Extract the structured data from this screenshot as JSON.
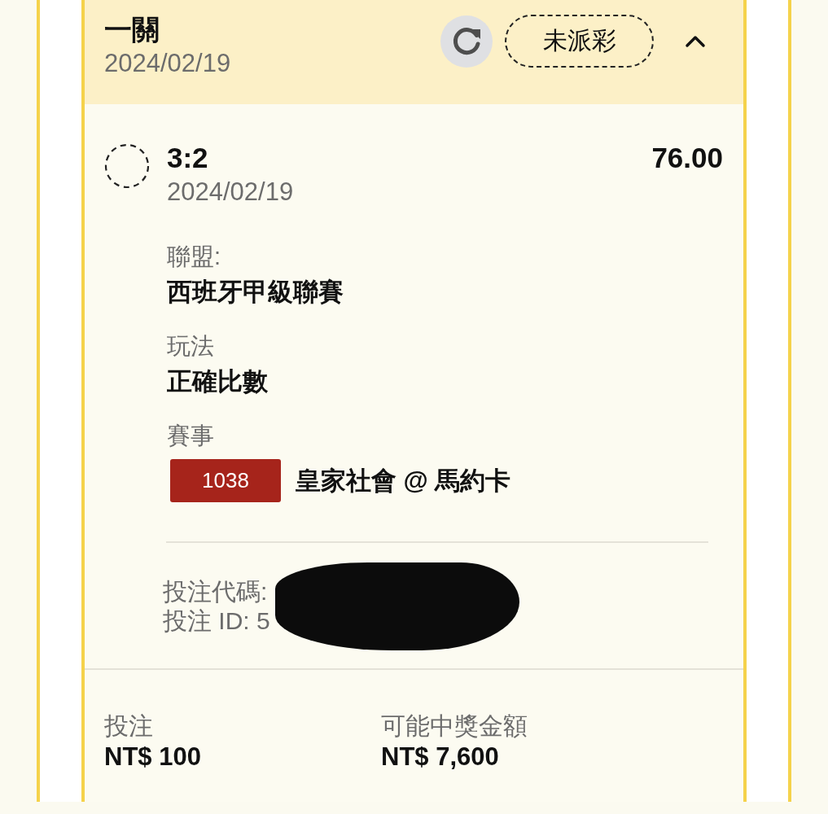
{
  "bet": {
    "title": "一關",
    "date": "2024/02/19",
    "status": "未派彩",
    "expanded": true
  },
  "selection": {
    "pick": "3:2",
    "odds": "76.00",
    "date": "2024/02/19",
    "details": [
      {
        "kind": "text",
        "label": "聯盟:",
        "value": "西班牙甲級聯賽"
      },
      {
        "kind": "text",
        "label": "玩法",
        "value": "正確比數"
      },
      {
        "kind": "match",
        "label": "賽事",
        "match_number": "1038",
        "value": "皇家社會 @ 馬約卡"
      }
    ]
  },
  "references": [
    "投注代碼:",
    "投注 ID: 5"
  ],
  "summary": [
    {
      "label": "投注",
      "value": "NT$ 100"
    },
    {
      "label": "可能中獎金額",
      "value": "NT$ 7,600"
    }
  ]
}
